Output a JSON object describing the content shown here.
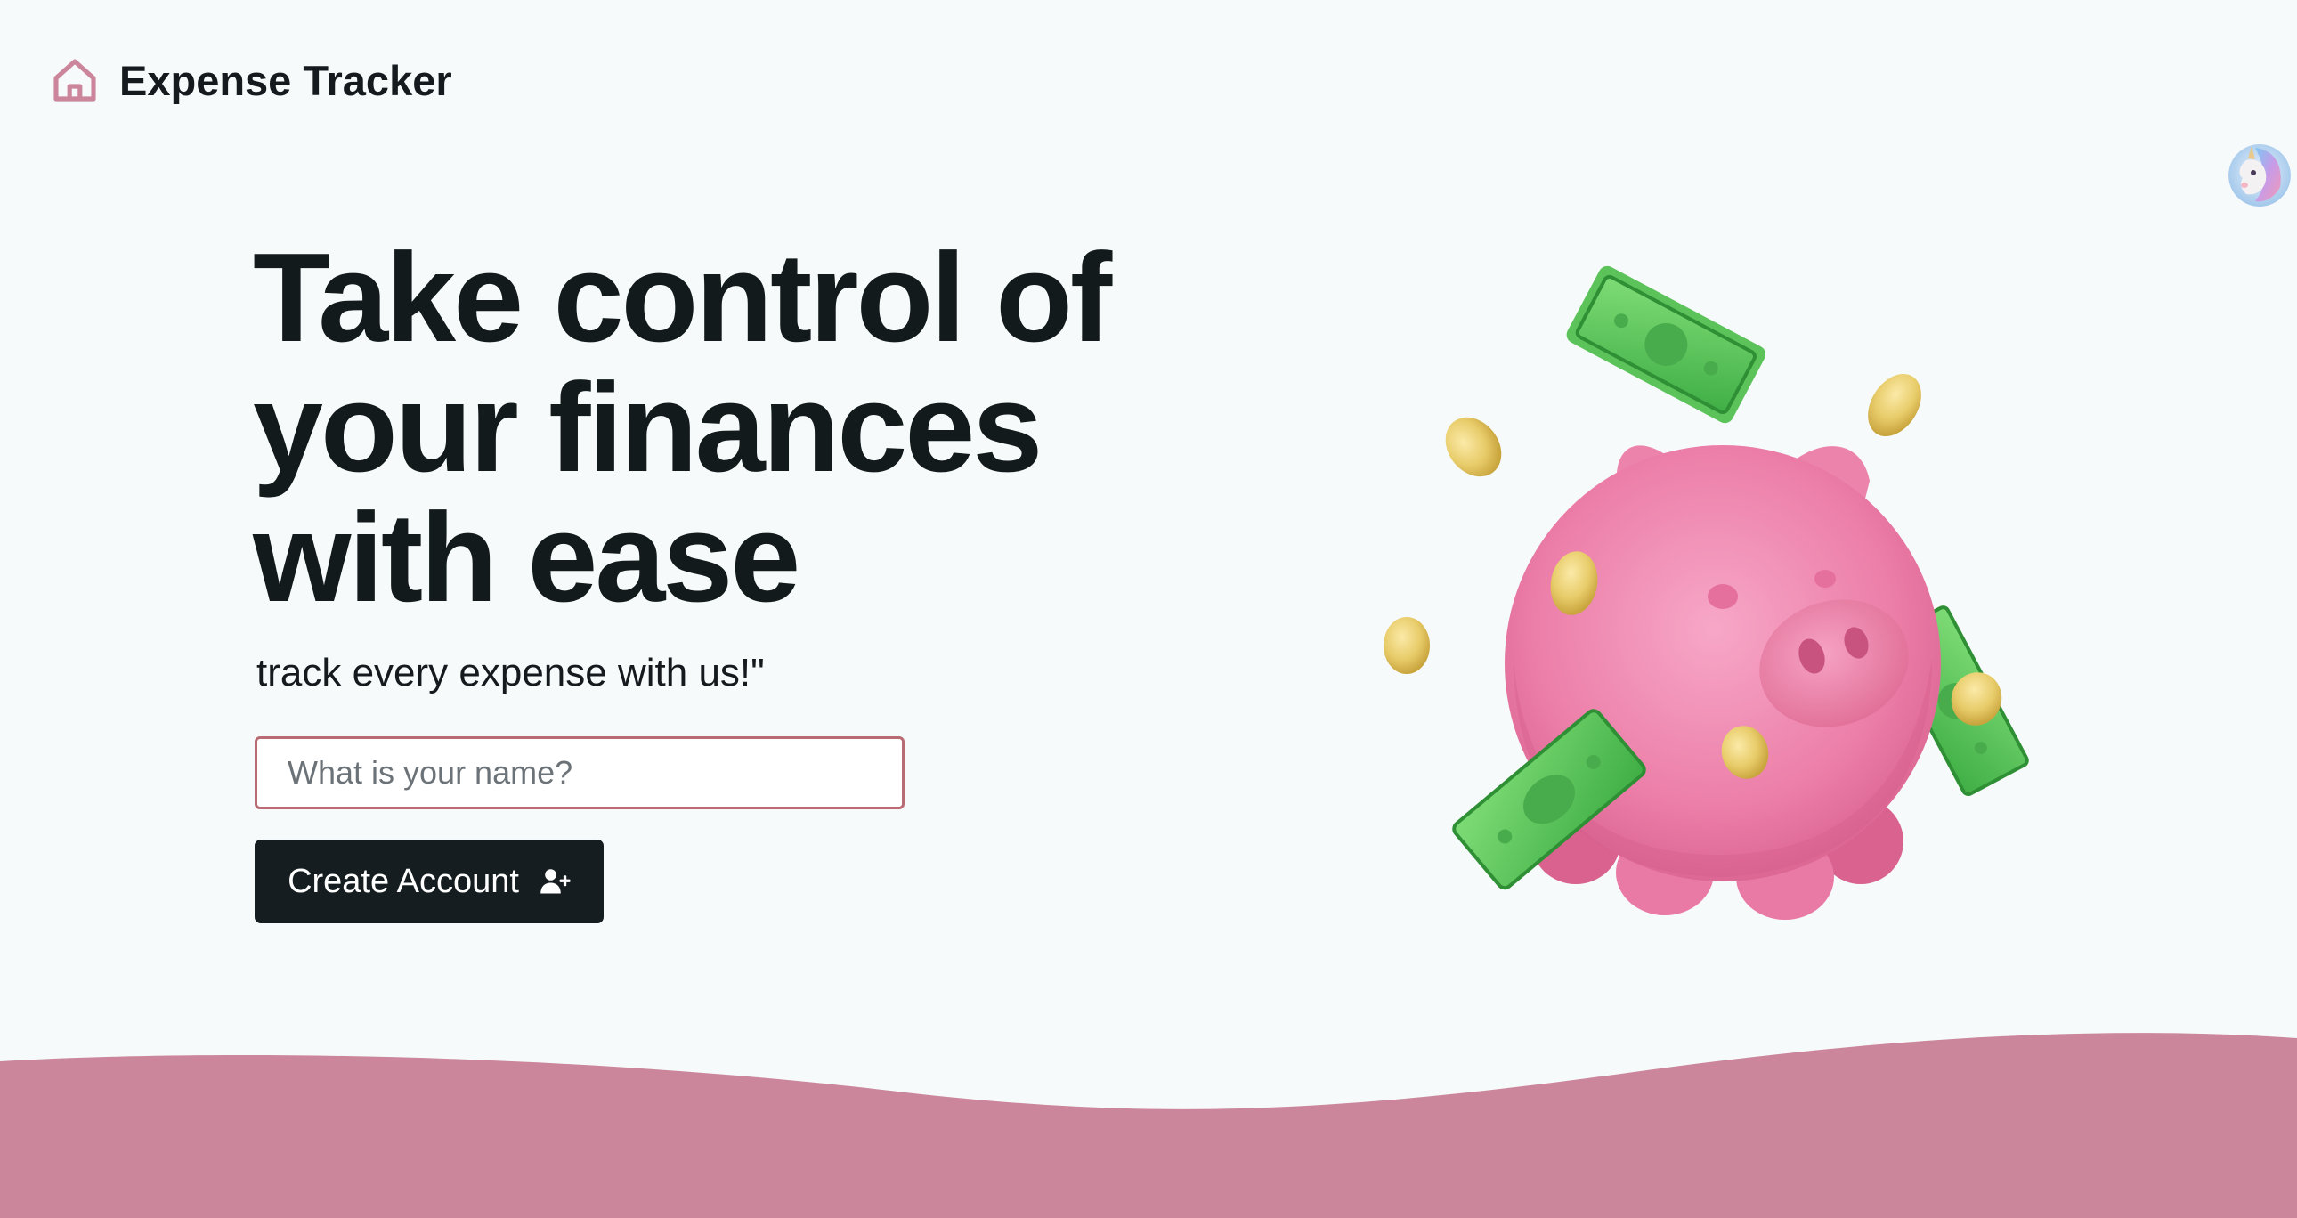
{
  "header": {
    "app_name": "Expense Tracker",
    "logo_icon": "house-icon"
  },
  "user": {
    "avatar_icon": "unicorn-avatar"
  },
  "hero": {
    "headline_lines": [
      "Take control of",
      "your finances",
      "with ease"
    ],
    "tagline": "track every expense with us!\"",
    "name_input": {
      "value": "",
      "placeholder": "What is your name?"
    },
    "create_button": {
      "label": "Create Account",
      "icon": "user-plus-icon"
    },
    "illustration": "piggy-bank-with-money"
  },
  "colors": {
    "brand_pink": "#cb869b",
    "input_border": "#b86b73",
    "button_dark": "#161d20",
    "background": "#f6fafa",
    "text_dark": "#141a1d"
  }
}
